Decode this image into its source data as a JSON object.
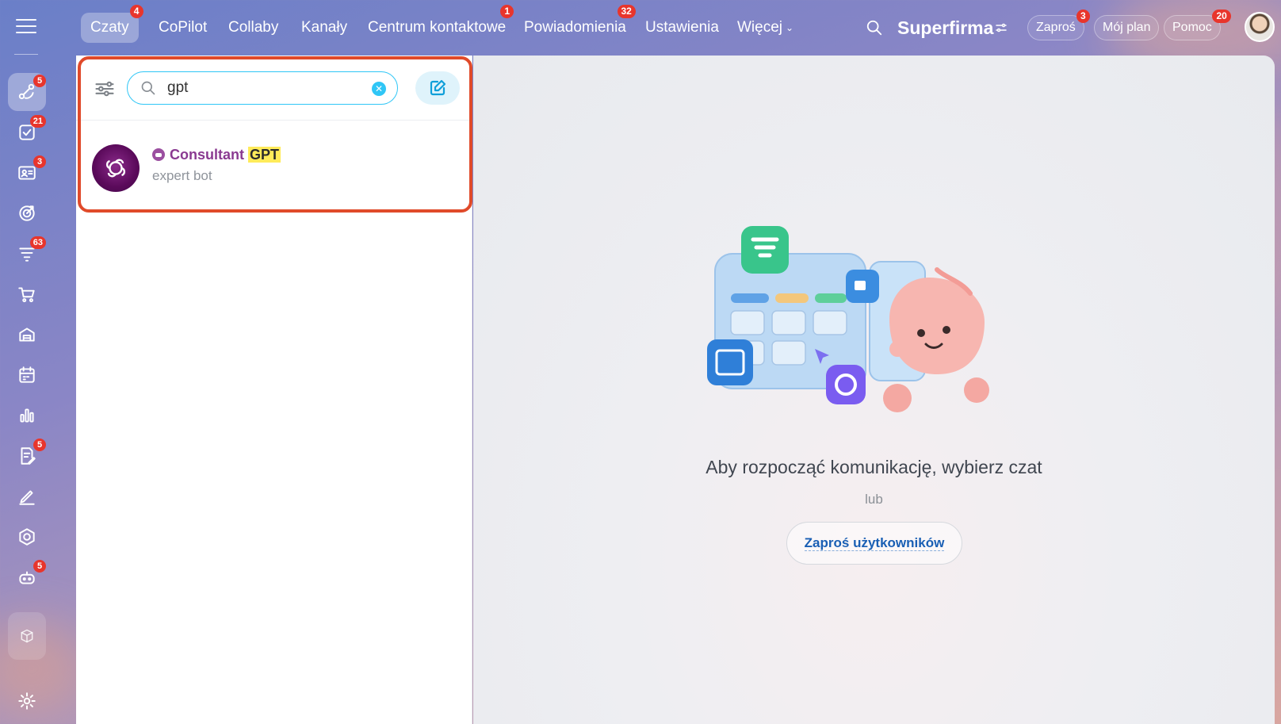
{
  "nav": {
    "tabs": [
      {
        "label": "Czaty",
        "badge": "4"
      },
      {
        "label": "CoPilot",
        "badge": ""
      },
      {
        "label": "Collaby",
        "badge": ""
      },
      {
        "label": "Kanały",
        "badge": ""
      },
      {
        "label": "Centrum kontaktowe",
        "badge": "1"
      },
      {
        "label": "Powiadomienia",
        "badge": "32"
      },
      {
        "label": "Ustawienia",
        "badge": ""
      },
      {
        "label": "Więcej",
        "badge": ""
      }
    ],
    "brand": "Superfirma",
    "invite": {
      "label": "Zaproś",
      "badge": "3"
    },
    "plan": {
      "label": "Mój plan"
    },
    "help": {
      "label": "Pomoc",
      "badge": "20"
    }
  },
  "sidebar": {
    "items": [
      {
        "icon": "messenger-icon",
        "badge": "5"
      },
      {
        "icon": "tasks-icon",
        "badge": "21"
      },
      {
        "icon": "contacts-icon",
        "badge": "3"
      },
      {
        "icon": "crm-target-icon",
        "badge": ""
      },
      {
        "icon": "funnel-icon",
        "badge": "63"
      },
      {
        "icon": "cart-icon",
        "badge": ""
      },
      {
        "icon": "inventory-icon",
        "badge": ""
      },
      {
        "icon": "calendar-icon",
        "badge": ""
      },
      {
        "icon": "analytics-icon",
        "badge": ""
      },
      {
        "icon": "documents-icon",
        "badge": "5"
      },
      {
        "icon": "sign-icon",
        "badge": ""
      },
      {
        "icon": "automation-icon",
        "badge": ""
      },
      {
        "icon": "copilot-bot-icon",
        "badge": "5"
      },
      {
        "icon": "market-box-icon",
        "badge": ""
      },
      {
        "icon": "gear-icon",
        "badge": ""
      }
    ]
  },
  "chat_list": {
    "search_value": "gpt",
    "results": [
      {
        "name_prefix": "Consultant ",
        "name_match": "GPT",
        "subtitle": "expert bot"
      }
    ]
  },
  "empty_state": {
    "title": "Aby rozpocząć komunikację, wybierz czat",
    "or": "lub",
    "invite_button": "Zaproś użytkowników"
  },
  "colors": {
    "accent": "#2fc6f6",
    "badge": "#e8352c",
    "highlight": "#e04a2a",
    "bot_name": "#8a3a91"
  }
}
